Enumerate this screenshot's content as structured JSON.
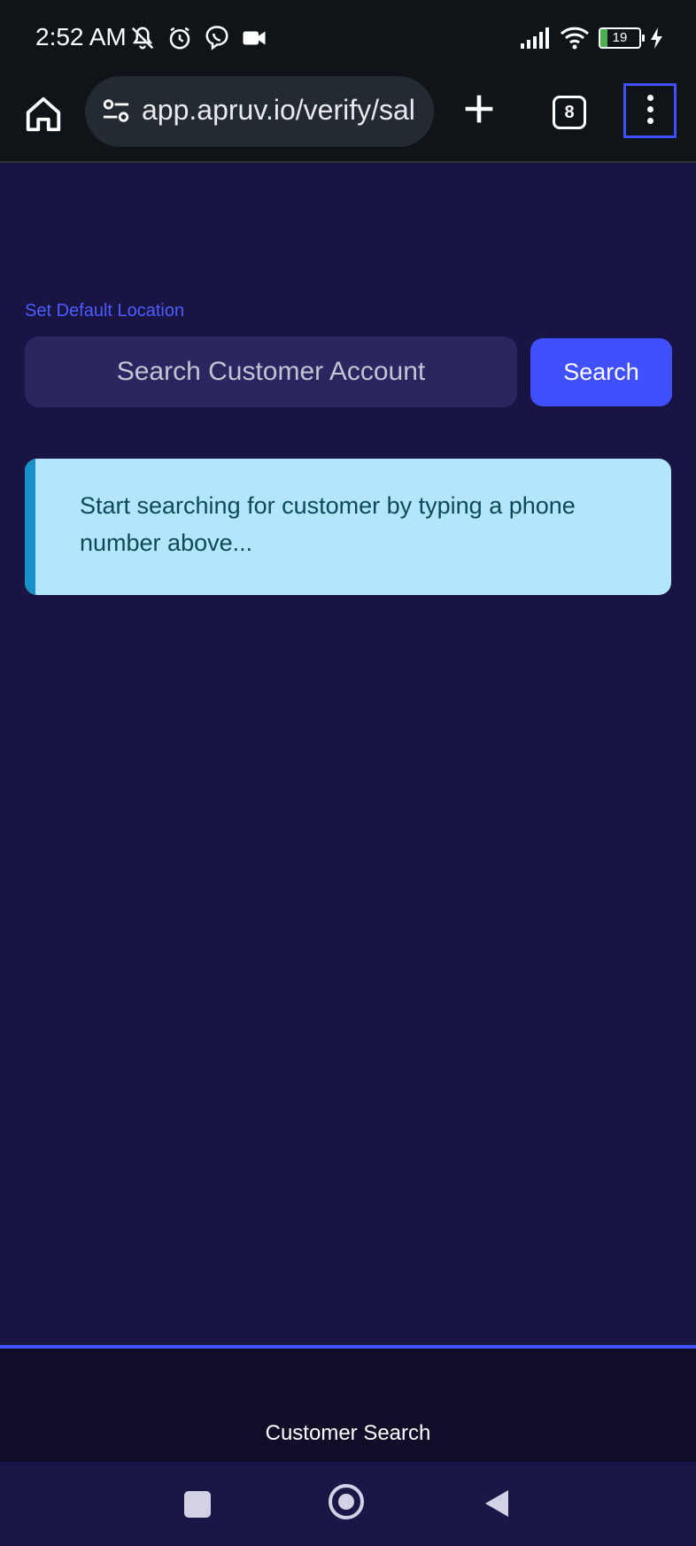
{
  "status_bar": {
    "time": "2:52 AM",
    "battery": "19",
    "icons": [
      "mute-icon",
      "alarm-icon",
      "viber-icon",
      "video-icon",
      "signal-icon",
      "wifi-icon",
      "battery-icon",
      "charging-icon"
    ]
  },
  "browser": {
    "url": "app.apruv.io/verify/sal",
    "tab_count": "8"
  },
  "page": {
    "set_location_link": "Set Default Location",
    "search_placeholder": "Search Customer Account",
    "search_button": "Search",
    "info_message": "Start searching for customer by typing a phone number above..."
  },
  "bottom_nav": {
    "label": "Customer Search"
  },
  "colors": {
    "background": "#181544",
    "accent": "#4050ff",
    "info_bg": "#b3e5fc"
  }
}
